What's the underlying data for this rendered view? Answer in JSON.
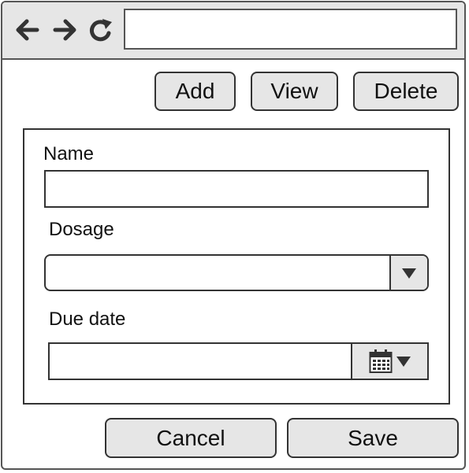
{
  "browser": {
    "address": "",
    "icons": {
      "back": "arrow-left-icon",
      "forward": "arrow-right-icon",
      "reload": "reload-icon"
    }
  },
  "toolbar": {
    "add_label": "Add",
    "view_label": "View",
    "delete_label": "Delete"
  },
  "form": {
    "name_label": "Name",
    "name_value": "",
    "dosage_label": "Dosage",
    "dosage_value": "",
    "due_date_label": "Due date",
    "due_date_value": ""
  },
  "footer": {
    "cancel_label": "Cancel",
    "save_label": "Save"
  },
  "colors": {
    "border": "#333333",
    "button_fill": "#e6e6e6",
    "chrome_fill": "#e6e6e6",
    "icon": "#333333"
  }
}
